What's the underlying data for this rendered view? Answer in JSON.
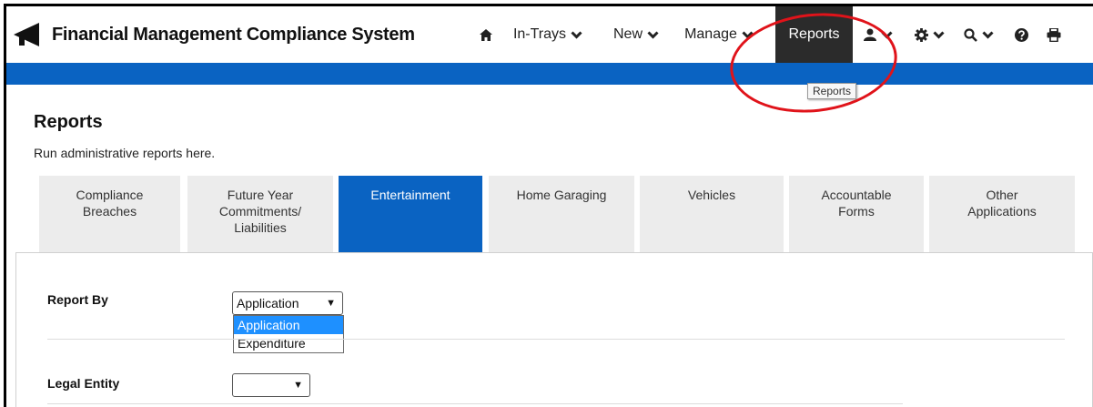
{
  "app": {
    "title": "Financial Management Compliance System"
  },
  "nav": {
    "in_trays": "In-Trays",
    "new": "New",
    "manage": "Manage",
    "reports": "Reports",
    "icons": [
      "home-icon",
      "user-icon",
      "gear-icon",
      "search-icon",
      "help-icon",
      "print-icon"
    ]
  },
  "tooltip": {
    "text": "Reports"
  },
  "page": {
    "title": "Reports",
    "subtitle": "Run administrative reports here."
  },
  "tabs": [
    {
      "label": "Compliance\nBreaches",
      "active": false
    },
    {
      "label": "Future Year\nCommitments/\nLiabilities",
      "active": false
    },
    {
      "label": "Entertainment",
      "active": true
    },
    {
      "label": "Home Garaging",
      "active": false
    },
    {
      "label": "Vehicles",
      "active": false
    },
    {
      "label": "Accountable\nForms",
      "active": false
    },
    {
      "label": "Other\nApplications",
      "active": false
    }
  ],
  "form": {
    "report_by": {
      "label": "Report By",
      "value": "Application",
      "options": [
        "Application",
        "Expenditure"
      ],
      "highlighted": "Application"
    },
    "legal_entity": {
      "label": "Legal Entity",
      "value": ""
    }
  },
  "colors": {
    "brand_blue": "#0a63c2",
    "nav_active": "#2b2b2b",
    "annotation_red": "#e0131a",
    "tab_inactive": "#ececec",
    "option_highlight": "#1e90ff"
  }
}
